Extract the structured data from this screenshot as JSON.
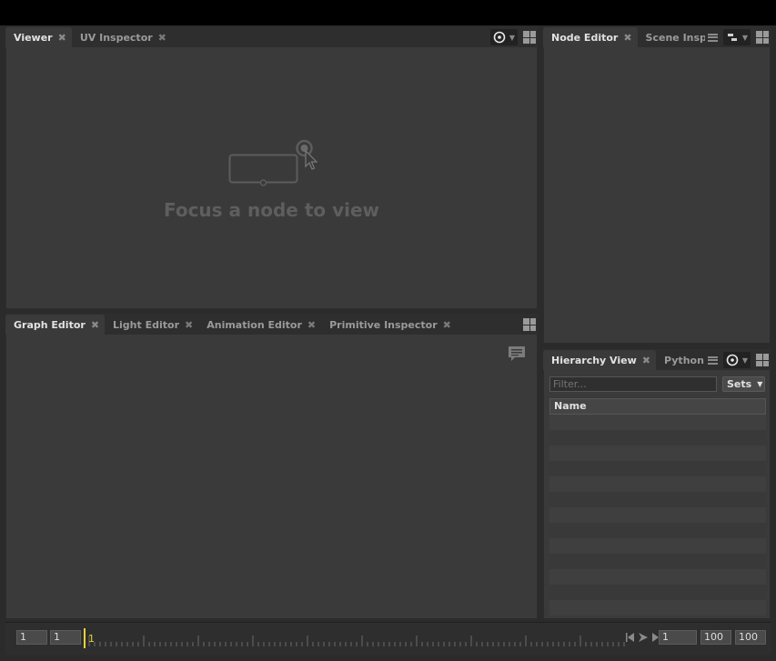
{
  "viewer_pane": {
    "tabs": [
      {
        "label": "Viewer"
      },
      {
        "label": "UV Inspector"
      }
    ],
    "empty_message": "Focus a node to view"
  },
  "node_pane": {
    "tabs": [
      {
        "label": "Node Editor"
      },
      {
        "label": "Scene Inspe"
      }
    ]
  },
  "graph_pane": {
    "tabs": [
      {
        "label": "Graph Editor"
      },
      {
        "label": "Light Editor"
      },
      {
        "label": "Animation Editor"
      },
      {
        "label": "Primitive Inspector"
      }
    ]
  },
  "hierarchy_pane": {
    "tabs": [
      {
        "label": "Hierarchy View"
      },
      {
        "label": "Python E"
      }
    ],
    "filter_placeholder": "Filter...",
    "sets_label": "Sets",
    "column_header": "Name"
  },
  "timeline": {
    "start_frame": "1",
    "range_start": "1",
    "current_frame": "1",
    "frame_field": "1",
    "range_end": "100",
    "end_frame": "100"
  },
  "colors": {
    "playhead": "#e8d233",
    "active_tab": "#3a3a3a"
  }
}
